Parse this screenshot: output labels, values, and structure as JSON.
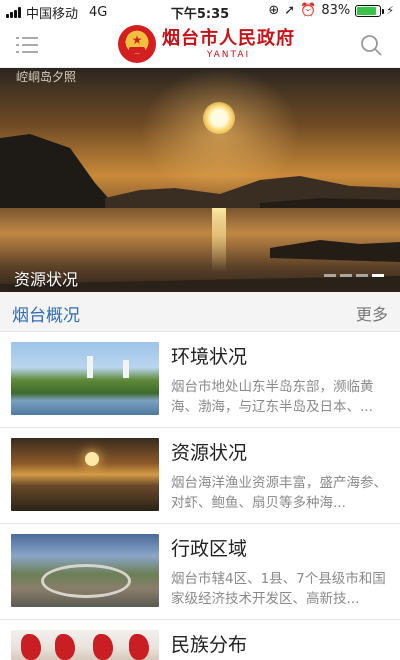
{
  "status_bar": {
    "carrier": "中国移动",
    "network": "4G",
    "time": "下午5:35",
    "battery_percent": "83%",
    "battery_level": 0.83,
    "icons": [
      "signal-icon",
      "lock-rotation-icon",
      "location-icon",
      "alarm-icon",
      "battery-icon",
      "charging-icon"
    ]
  },
  "header": {
    "logo_cn": "烟台市人民政府",
    "logo_en": "YANTAI",
    "menu_icon": "menu-icon",
    "search_icon": "search-icon",
    "brand_color": "#c4141a"
  },
  "banner": {
    "top_caption": "崆峒岛夕照",
    "caption": "资源状况",
    "slide_count": 4,
    "active_slide": 4
  },
  "section": {
    "title": "烟台概况",
    "more": "更多",
    "title_color": "#2f6bb0"
  },
  "items": [
    {
      "title": "环境状况",
      "desc": "烟台市地处山东半岛东部，濒临黄海、渤海，与辽东半岛及日本、..."
    },
    {
      "title": "资源状况",
      "desc": "烟台海洋渔业资源丰富，盛产海参、对虾、鲍鱼、扇贝等多种海..."
    },
    {
      "title": "行政区域",
      "desc": "烟台市辖4区、1县、7个县级市和国家级经济技术开发区、高新技..."
    },
    {
      "title": "民族分布",
      "desc": ""
    }
  ]
}
